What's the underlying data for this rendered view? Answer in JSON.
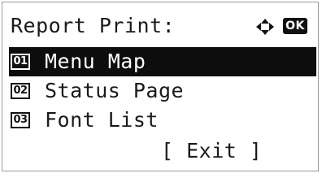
{
  "header": {
    "title": "Report Print:",
    "nav_icon": "four-way-arrow-icon",
    "ok_label": "OK"
  },
  "menu": {
    "items": [
      {
        "number": "01",
        "label": "Menu Map",
        "selected": true
      },
      {
        "number": "02",
        "label": "Status Page",
        "selected": false
      },
      {
        "number": "03",
        "label": "Font List",
        "selected": false
      }
    ]
  },
  "footer": {
    "exit_label": "[ Exit ]"
  },
  "colors": {
    "selection_background": "#0d0d0d",
    "text": "#1a1a1a",
    "screen_background": "#ffffff"
  }
}
